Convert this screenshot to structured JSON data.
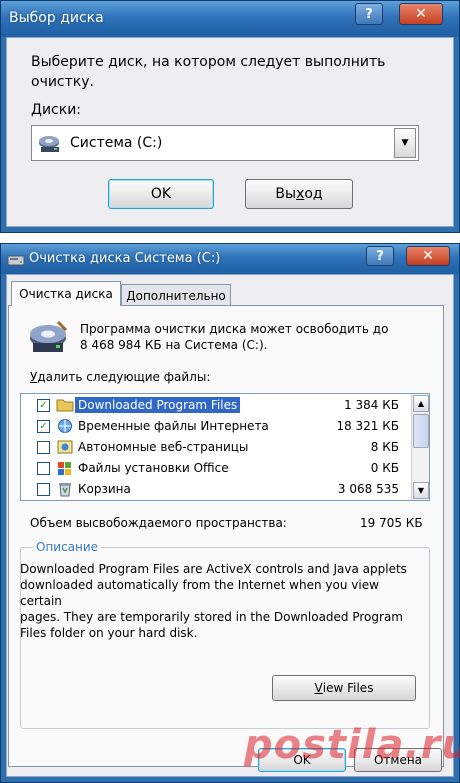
{
  "drive_dialog": {
    "title": "Выбор диска",
    "help_glyph": "?",
    "close_glyph": "✕",
    "prompt_line1": "Выберите диск, на котором следует выполнить",
    "prompt_line2": "очистку.",
    "drives_label": "Диски:",
    "selected_drive": "Система (C:)",
    "ok_label": "OK",
    "exit_pre": "Вы",
    "exit_underlined": "х",
    "exit_post": "од"
  },
  "cleanup_dialog": {
    "title": "Очистка диска Система (C:)",
    "help_glyph": "?",
    "close_glyph": "✕",
    "tabs": [
      "Очистка диска",
      "Дополнительно"
    ],
    "intro_line1": "Программа очистки диска может освободить до",
    "intro_line2": "8 468 984 КБ на Система (C:).",
    "list_label_underlined": "У",
    "list_label_rest": "далить следующие файлы:",
    "files": [
      {
        "name": "Downloaded Program Files",
        "size": "1 384 КБ",
        "checked": true,
        "selected": true
      },
      {
        "name": "Временные файлы Интернета",
        "size": "18 321 КБ",
        "checked": true,
        "selected": false
      },
      {
        "name": "Автономные веб-страницы",
        "size": "8 КБ",
        "checked": false,
        "selected": false
      },
      {
        "name": "Файлы установки Office",
        "size": "0 КБ",
        "checked": false,
        "selected": false
      },
      {
        "name": "Корзина",
        "size": "3 068 535",
        "checked": false,
        "selected": false
      }
    ],
    "space_label": "Объем высвобождаемого пространства:",
    "space_value": "19 705 КБ",
    "description_legend": "Описание",
    "description_lines": [
      "Downloaded Program Files are ActiveX controls and Java applets",
      "downloaded automatically from the Internet when you view certain",
      "pages. They are temporarily stored in the Downloaded Program",
      "Files folder on your hard disk."
    ],
    "view_files_underlined": "V",
    "view_files_rest": "iew Files",
    "ok_label": "OK",
    "cancel_label": "Отмена"
  },
  "watermark": "postila.ru",
  "colors": {
    "titlebar": "#2f72b8",
    "selection": "#3168c6",
    "legend": "#3a78c7",
    "watermark": "#d81f26"
  }
}
